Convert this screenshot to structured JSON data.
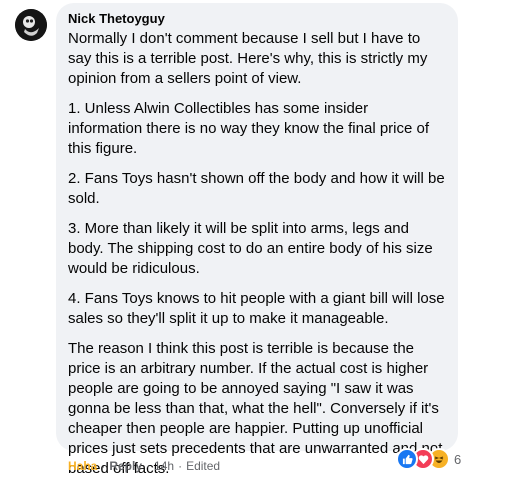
{
  "comment": {
    "author": "Nick Thetoyguy",
    "paragraphs": [
      "Normally I don't comment because I sell but I have to say this is a terrible post. Here's why, this is strictly my opinion from a sellers point of view.",
      "1. Unless Alwin Collectibles has some insider information there is no way they know the final price of this figure.",
      "2. Fans Toys hasn't shown off the body and how it will be sold.",
      "3. More than likely it will be split into arms, legs and body. The shipping cost to do an entire body of his size would be ridiculous.",
      "4. Fans Toys knows to hit people with a giant bill will lose sales so they'll split it up to make it manageable.",
      "The reason I think this post is terrible is because the price is an arbitrary number. If the actual cost is higher people are going to be annoyed saying \"I saw it was gonna be less than that, what the hell\". Conversely if it's cheaper then people are happier. Putting up unofficial prices just sets precedents that are unwarranted and not based off facts."
    ],
    "reactions": {
      "icons": [
        "like-icon",
        "love-icon",
        "haha-icon"
      ],
      "count": "6",
      "colors": {
        "like": "#1877f2",
        "love": "#f33e58",
        "haha": "#f7b125"
      }
    },
    "actions": {
      "reaction_label": "Haha",
      "reply_label": "Reply",
      "separator": "·",
      "time": "14h",
      "edited": "Edited"
    }
  }
}
